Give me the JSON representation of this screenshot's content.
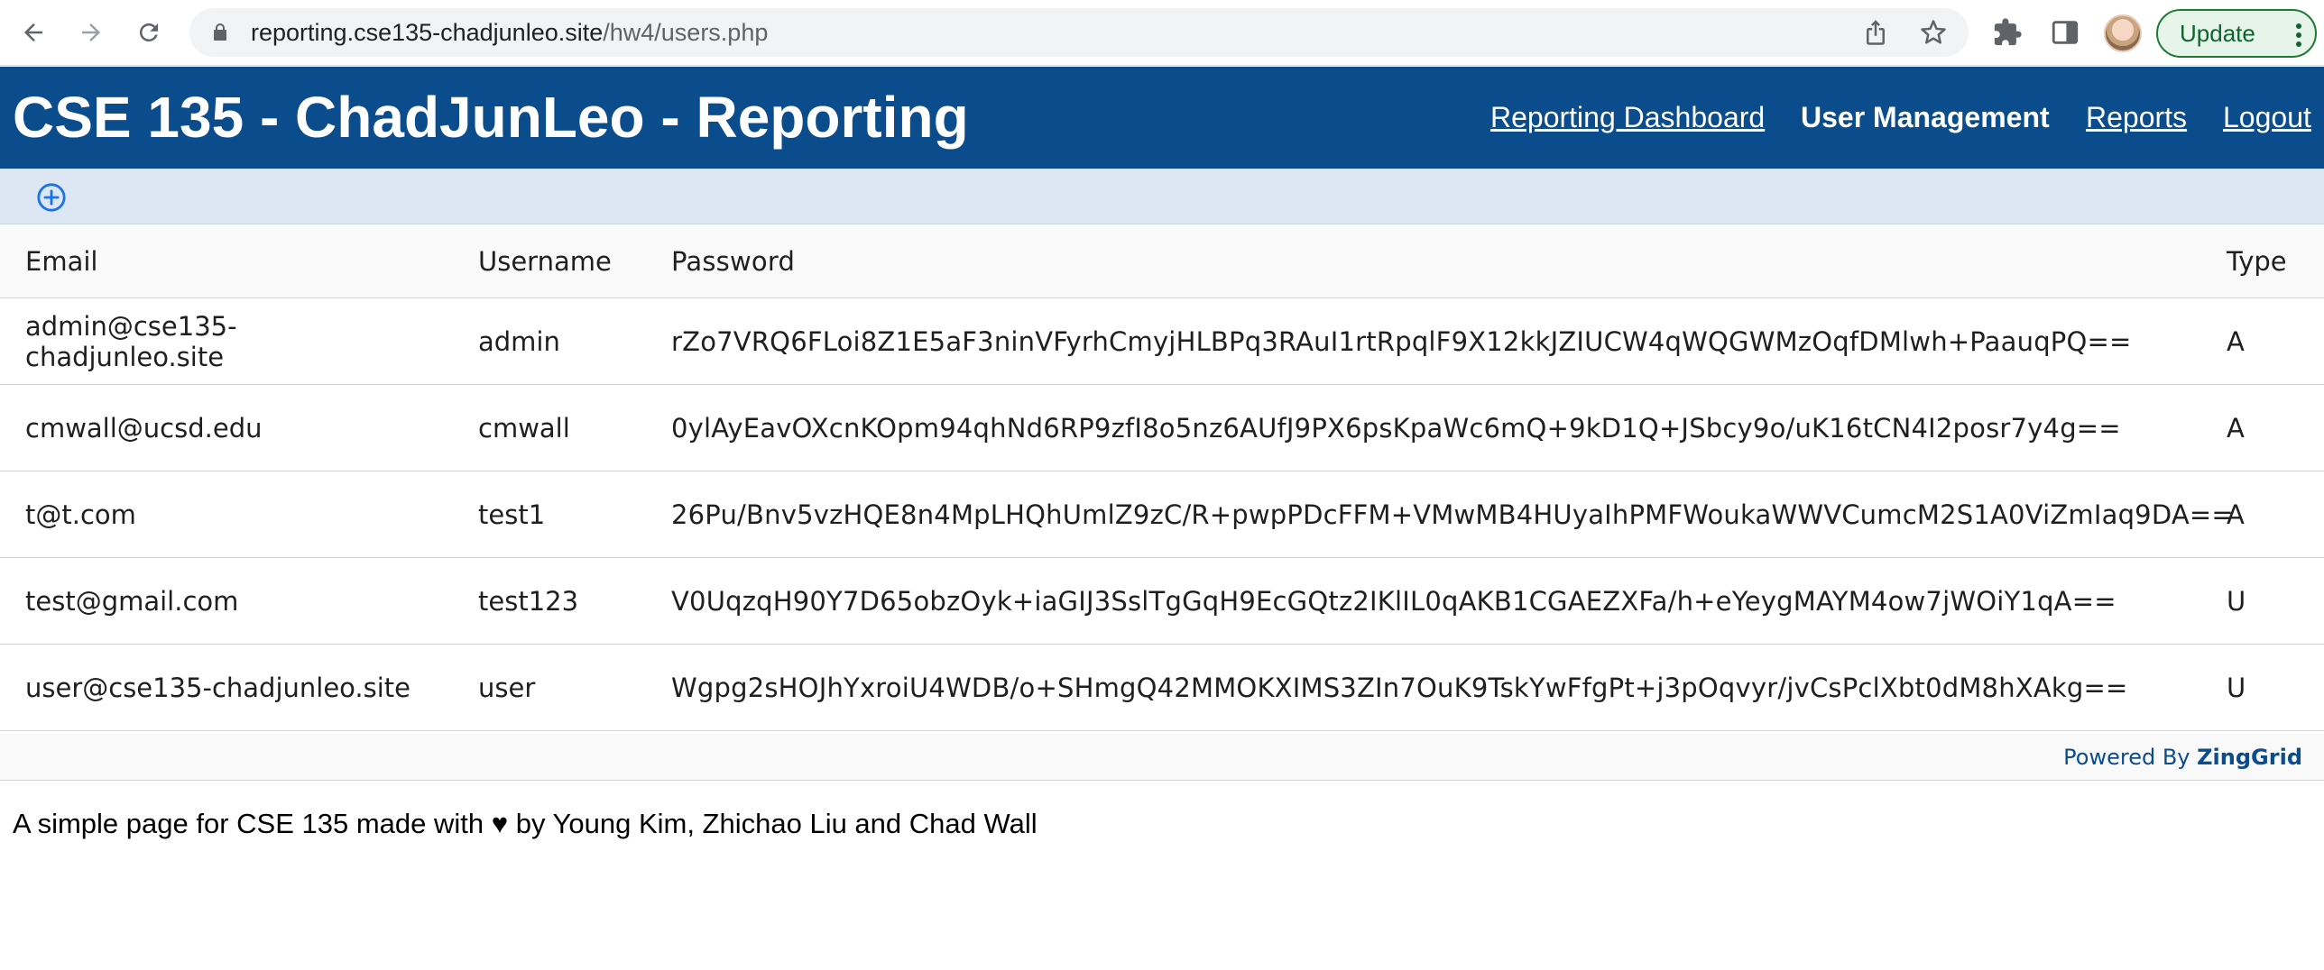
{
  "browser": {
    "url_host": "reporting.cse135-chadjunleo.site",
    "url_path": "/hw4/users.php",
    "update_label": "Update"
  },
  "header": {
    "title": "CSE 135 - ChadJunLeo - Reporting",
    "nav": [
      {
        "label": "Reporting Dashboard",
        "active": false
      },
      {
        "label": "User Management",
        "active": true
      },
      {
        "label": "Reports",
        "active": false
      },
      {
        "label": "Logout",
        "active": false
      }
    ]
  },
  "grid": {
    "columns": [
      "Email",
      "Username",
      "Password",
      "Type"
    ],
    "rows": [
      {
        "email": "admin@cse135-chadjunleo.site",
        "username": "admin",
        "password": "rZo7VRQ6FLoi8Z1E5aF3ninVFyrhCmyjHLBPq3RAuI1rtRpqlF9X12kkJZIUCW4qWQGWMzOqfDMlwh+PaauqPQ==",
        "type": "A"
      },
      {
        "email": "cmwall@ucsd.edu",
        "username": "cmwall",
        "password": "0ylAyEavOXcnKOpm94qhNd6RP9zfI8o5nz6AUfJ9PX6psKpaWc6mQ+9kD1Q+JSbcy9o/uK16tCN4I2posr7y4g==",
        "type": "A"
      },
      {
        "email": "t@t.com",
        "username": "test1",
        "password": "26Pu/Bnv5vzHQE8n4MpLHQhUmlZ9zC/R+pwpPDcFFM+VMwMB4HUyaIhPMFWoukaWWVCumcM2S1A0ViZmIaq9DA==",
        "type": "A"
      },
      {
        "email": "test@gmail.com",
        "username": "test123",
        "password": "V0UqzqH90Y7D65obzOyk+iaGIJ3SslTgGqH9EcGQtz2IKlIL0qAKB1CGAEZXFa/h+eYeygMAYM4ow7jWOiY1qA==",
        "type": "U"
      },
      {
        "email": "user@cse135-chadjunleo.site",
        "username": "user",
        "password": "Wgpg2sHOJhYxroiU4WDB/o+SHmgQ42MMOKXIMS3ZIn7OuK9TskYwFfgPt+j3pOqvyr/jvCsPclXbt0dM8hXAkg==",
        "type": "U"
      }
    ],
    "powered_prefix": "Powered By",
    "powered_brand": "ZingGrid"
  },
  "footer": {
    "text": "A simple page for CSE 135 made with ♥ by Young Kim, Zhichao Liu and Chad Wall"
  },
  "colors": {
    "header_bg": "#0b4d8c",
    "toolbar_bg": "#dde7f3",
    "accent_blue": "#1a73e8",
    "update_green": "#0d652d"
  }
}
